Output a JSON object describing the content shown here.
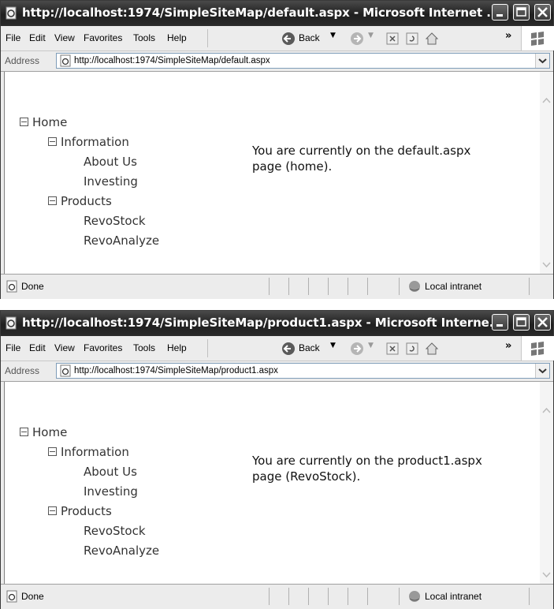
{
  "windows": [
    {
      "title": "http://localhost:1974/SimpleSiteMap/default.aspx - Microsoft Internet ...",
      "address_label": "Address",
      "address_value": "http://localhost:1974/SimpleSiteMap/default.aspx",
      "menus": [
        "File",
        "Edit",
        "View",
        "Favorites",
        "Tools",
        "Help"
      ],
      "back_label": "Back",
      "tree": {
        "home": "Home",
        "information": "Information",
        "about_us": "About Us",
        "investing": "Investing",
        "products": "Products",
        "revostock": "RevoStock",
        "revoanalyze": "RevoAnalyze"
      },
      "message_line1": "You are currently on the default.aspx",
      "message_line2": "page (home).",
      "status": "Done",
      "zone": "Local intranet"
    },
    {
      "title": "http://localhost:1974/SimpleSiteMap/product1.aspx - Microsoft Interne...",
      "address_label": "Address",
      "address_value": "http://localhost:1974/SimpleSiteMap/product1.aspx",
      "menus": [
        "File",
        "Edit",
        "View",
        "Favorites",
        "Tools",
        "Help"
      ],
      "back_label": "Back",
      "tree": {
        "home": "Home",
        "information": "Information",
        "about_us": "About Us",
        "investing": "Investing",
        "products": "Products",
        "revostock": "RevoStock",
        "revoanalyze": "RevoAnalyze"
      },
      "message_line1": "You are currently on the product1.aspx",
      "message_line2": "page (RevoStock).",
      "status": "Done",
      "zone": "Local intranet"
    }
  ]
}
